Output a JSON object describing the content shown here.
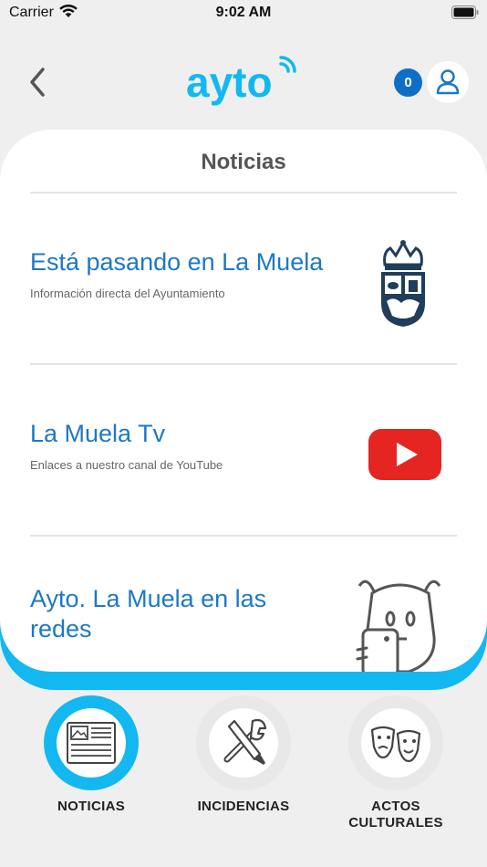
{
  "status_bar": {
    "carrier": "Carrier",
    "time": "9:02 AM"
  },
  "header": {
    "logo_text": "ayto",
    "notification_count": "0",
    "back_icon": "chevron-left-icon",
    "user_icon": "user-icon",
    "brand_color": "#13b8f0",
    "accent_color": "#1d78c5"
  },
  "card": {
    "title": "Noticias",
    "items": [
      {
        "title": "Está pasando en La Muela",
        "subtitle": "Información directa del Ayuntamiento",
        "thumb": "coat-of-arms-icon"
      },
      {
        "title": "La Muela Tv",
        "subtitle": "Enlaces a nuestro canal de YouTube",
        "thumb": "youtube-icon"
      },
      {
        "title": "Ayto. La Muela en las redes",
        "subtitle": "",
        "thumb": "selfie-character-icon"
      }
    ]
  },
  "bottom_nav": {
    "items": [
      {
        "label": "NOTICIAS",
        "icon": "newspaper-icon",
        "active": true
      },
      {
        "label": "INCIDENCIAS",
        "icon": "tools-icon",
        "active": false
      },
      {
        "label": "ACTOS CULTURALES",
        "icon": "theater-masks-icon",
        "active": false
      }
    ]
  }
}
